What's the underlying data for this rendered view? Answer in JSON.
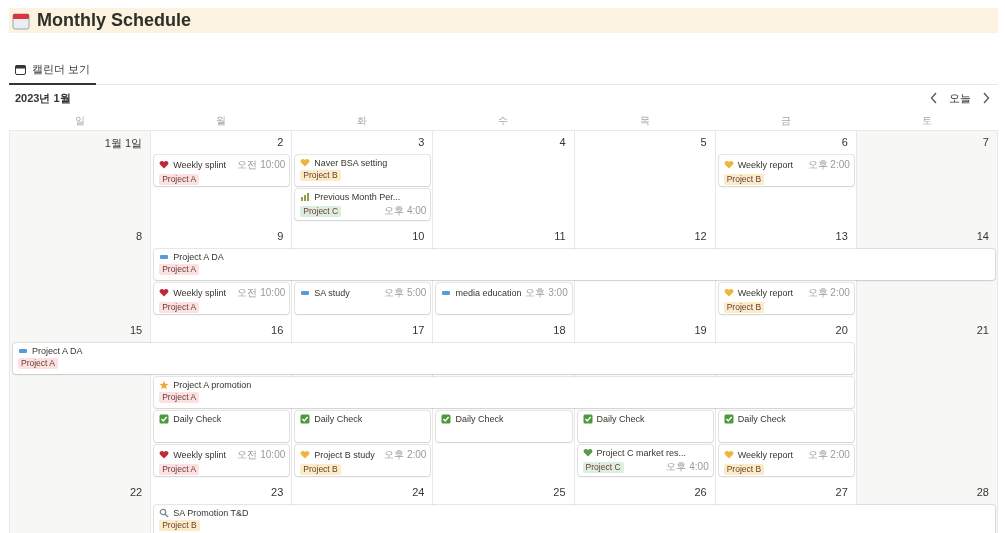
{
  "page": {
    "title": "Monthly Schedule"
  },
  "tabs": [
    {
      "label": "캘린더 보기",
      "selected": true
    }
  ],
  "month": "2023년 1월",
  "today_button": "오늘",
  "weekdays": [
    "일",
    "월",
    "화",
    "수",
    "목",
    "금",
    "토"
  ],
  "weeks": [
    {
      "days": [
        "1월 1일",
        "2",
        "3",
        "4",
        "5",
        "6",
        "7"
      ],
      "events": [
        {
          "title": "Weekly splint",
          "kind": "heart",
          "color": "#c0293a",
          "time": "오전 10:00",
          "tag": {
            "label": "Project A",
            "color": "#fbe1e1"
          }
        },
        {
          "title": "Naver BSA setting",
          "kind": "heart",
          "color": "#f0b43c",
          "tag": {
            "label": "Project B",
            "color": "#fbecc8"
          }
        },
        {
          "title": "Previous Month Per...",
          "kind": "chart",
          "color": "#8aa04a",
          "time": "오후 4:00",
          "tag": {
            "label": "Project C",
            "color": "#dcefdf"
          }
        },
        {
          "title": "Weekly report",
          "kind": "heart",
          "color": "#f0b43c",
          "time": "오후 2:00",
          "tag": {
            "label": "Project B",
            "color": "#fbecc8"
          }
        }
      ]
    },
    {
      "days": [
        "8",
        "9",
        "10",
        "11",
        "12",
        "13",
        "14"
      ],
      "events": [
        {
          "title": "Project A DA",
          "kind": "note",
          "color": "#5b9bd5",
          "tag": {
            "label": "Project A",
            "color": "#fbe1e1"
          }
        },
        {
          "title": "Weekly splint",
          "kind": "heart",
          "color": "#c0293a",
          "time": "오전 10:00",
          "tag": {
            "label": "Project A",
            "color": "#fbe1e1"
          }
        },
        {
          "title": "SA study",
          "kind": "note",
          "color": "#5b9bd5",
          "time": "오후 5:00"
        },
        {
          "title": "media education",
          "kind": "note",
          "color": "#5b9bd5",
          "time": "오후 3:00"
        },
        {
          "title": "Weekly report",
          "kind": "heart",
          "color": "#f0b43c",
          "time": "오후 2:00",
          "tag": {
            "label": "Project B",
            "color": "#fbecc8"
          }
        }
      ]
    },
    {
      "days": [
        "15",
        "16",
        "17",
        "18",
        "19",
        "20",
        "21"
      ],
      "events": [
        {
          "title": "Project A DA",
          "kind": "note",
          "color": "#5b9bd5",
          "tag": {
            "label": "Project A",
            "color": "#fbe1e1"
          }
        },
        {
          "title": "Project A promotion",
          "kind": "star",
          "color": "#f0a830",
          "tag": {
            "label": "Project A",
            "color": "#fbe1e1"
          }
        },
        {
          "title": "Daily Check",
          "kind": "check",
          "color": "#4a9a3a"
        },
        {
          "title": "Daily Check",
          "kind": "check",
          "color": "#4a9a3a"
        },
        {
          "title": "Daily Check",
          "kind": "check",
          "color": "#4a9a3a"
        },
        {
          "title": "Daily Check",
          "kind": "check",
          "color": "#4a9a3a"
        },
        {
          "title": "Daily Check",
          "kind": "check",
          "color": "#4a9a3a"
        },
        {
          "title": "Weekly splint",
          "kind": "heart",
          "color": "#c0293a",
          "time": "오전 10:00",
          "tag": {
            "label": "Project A",
            "color": "#fbe1e1"
          }
        },
        {
          "title": "Project B study",
          "kind": "heart",
          "color": "#f0b43c",
          "time": "오후 2:00",
          "tag": {
            "label": "Project B",
            "color": "#fbecc8"
          }
        },
        {
          "title": "Project C market res...",
          "kind": "heart",
          "color": "#5a9a4a",
          "time": "오후 4:00",
          "tag": {
            "label": "Project C",
            "color": "#dcefdf"
          }
        },
        {
          "title": "Weekly report",
          "kind": "heart",
          "color": "#f0b43c",
          "time": "오후 2:00",
          "tag": {
            "label": "Project B",
            "color": "#fbecc8"
          }
        }
      ]
    },
    {
      "days": [
        "22",
        "23",
        "24",
        "25",
        "26",
        "27",
        "28"
      ],
      "events": [
        {
          "title": "SA Promotion T&D",
          "kind": "search",
          "color": "#7a8aa0",
          "tag": {
            "label": "Project B",
            "color": "#fbecc8"
          }
        }
      ]
    }
  ]
}
